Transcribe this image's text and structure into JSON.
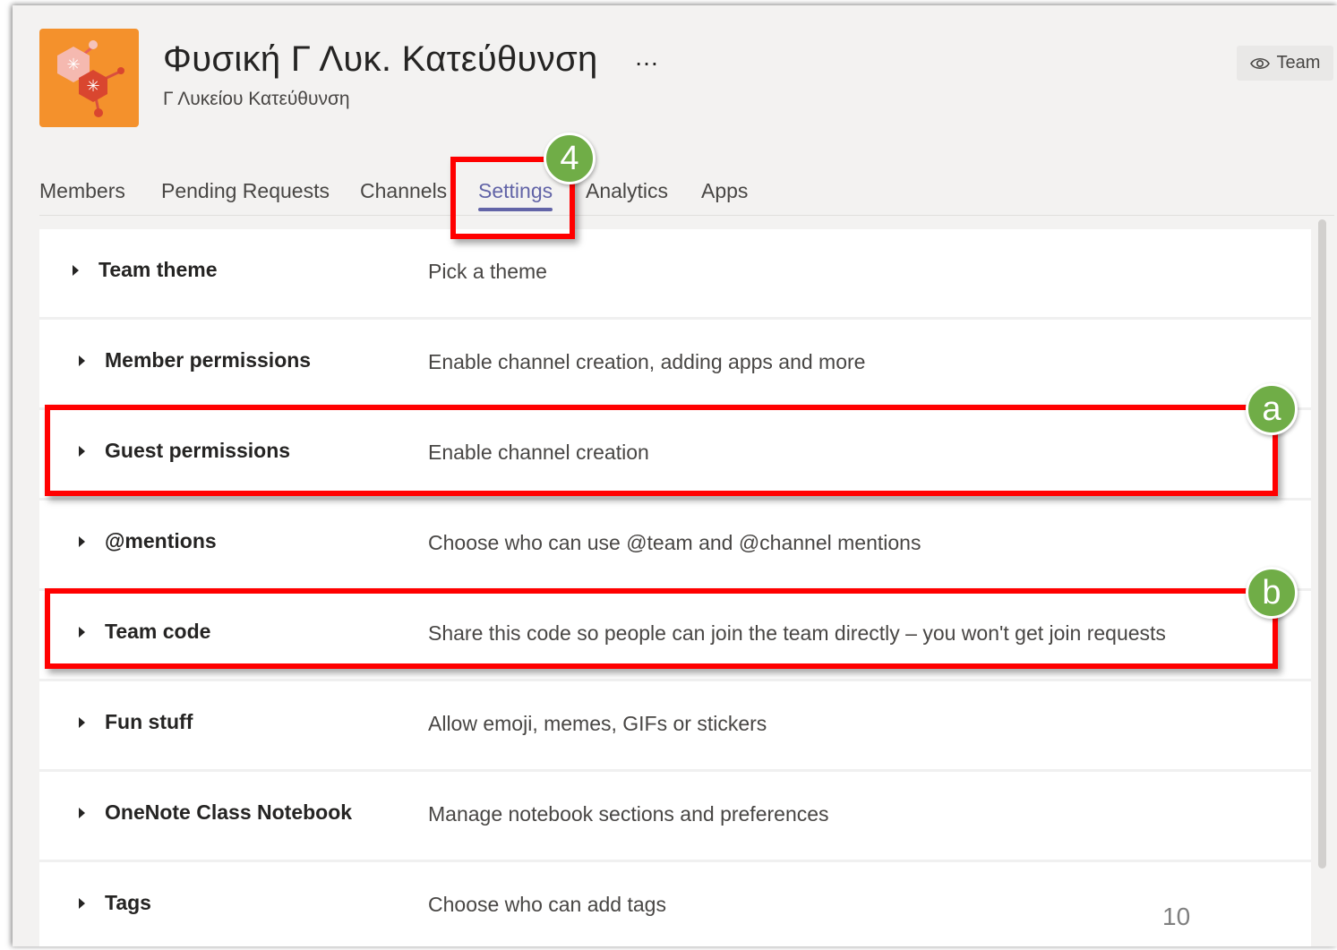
{
  "header": {
    "team_title": "Φυσική Γ Λυκ. Κατεύθυνση",
    "more_icon": "…",
    "team_subtitle": "Γ Λυκείου Κατεύθυνση",
    "team_button_label": "Team",
    "team_button_icon": "eye-icon",
    "logo_color": "#f4912c"
  },
  "tabs": [
    {
      "label": "Members",
      "active": false
    },
    {
      "label": "Pending Requests",
      "active": false
    },
    {
      "label": "Channels",
      "active": false
    },
    {
      "label": "Settings",
      "active": true
    },
    {
      "label": "Analytics",
      "active": false
    },
    {
      "label": "Apps",
      "active": false
    }
  ],
  "settings": [
    {
      "label": "Team theme",
      "description": "Pick a theme"
    },
    {
      "label": "Member permissions",
      "description": "Enable channel creation, adding apps and more"
    },
    {
      "label": "Guest permissions",
      "description": "Enable channel creation"
    },
    {
      "label": "@mentions",
      "description": "Choose who can use @team and @channel mentions"
    },
    {
      "label": "Team code",
      "description": "Share this code so people can join the team directly – you won't get join requests"
    },
    {
      "label": "Fun stuff",
      "description": "Allow emoji, memes, GIFs or stickers"
    },
    {
      "label": "OneNote Class Notebook",
      "description": "Manage notebook sections and preferences"
    },
    {
      "label": "Tags",
      "description": "Choose who can add tags"
    }
  ],
  "annotations": {
    "step_badge": "4",
    "guest_badge": "a",
    "team_code_badge": "b",
    "highlight_color": "#ff0000",
    "badge_color": "#70ad47"
  },
  "page_number": "10",
  "colors": {
    "accent": "#6264a7",
    "background": "#f3f2f1"
  }
}
